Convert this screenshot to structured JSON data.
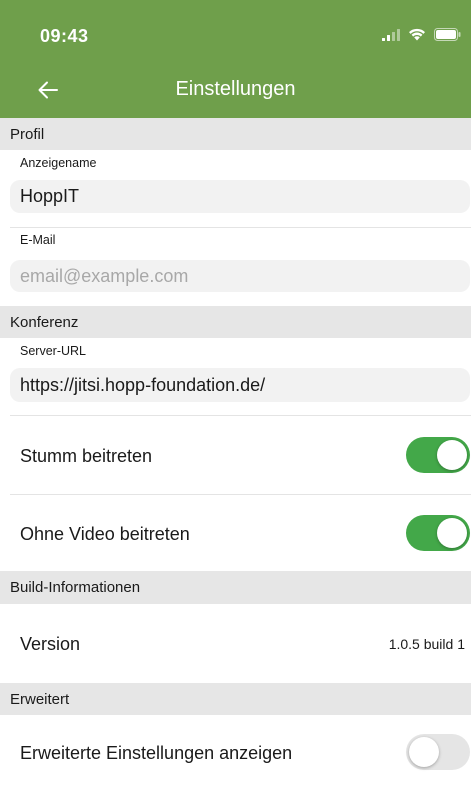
{
  "status_bar": {
    "time": "09:43",
    "icons": [
      "signal-icon",
      "wifi-icon",
      "battery-icon"
    ]
  },
  "nav": {
    "title": "Einstellungen",
    "back_icon": "arrow-left-icon"
  },
  "sections": {
    "profile": {
      "title": "Profil",
      "display_name_label": "Anzeigename",
      "display_name_value": "HoppIT",
      "email_label": "E-Mail",
      "email_placeholder": "email@example.com"
    },
    "conference": {
      "title": "Konferenz",
      "server_url_label": "Server-URL",
      "server_url_value": "https://jitsi.hopp-foundation.de/",
      "join_muted_label": "Stumm beitreten",
      "join_muted_on": true,
      "join_no_video_label": "Ohne Video beitreten",
      "join_no_video_on": true
    },
    "build": {
      "title": "Build-Informationen",
      "version_label": "Version",
      "version_value": "1.0.5 build 1"
    },
    "advanced": {
      "title": "Erweitert",
      "show_advanced_label": "Erweiterte Einstellungen anzeigen",
      "show_advanced_on": false
    }
  },
  "colors": {
    "header": "#6f9f4b",
    "toggle_on": "#43a849",
    "toggle_off": "#e5e5e5",
    "section_bg": "#e6e6e6"
  }
}
